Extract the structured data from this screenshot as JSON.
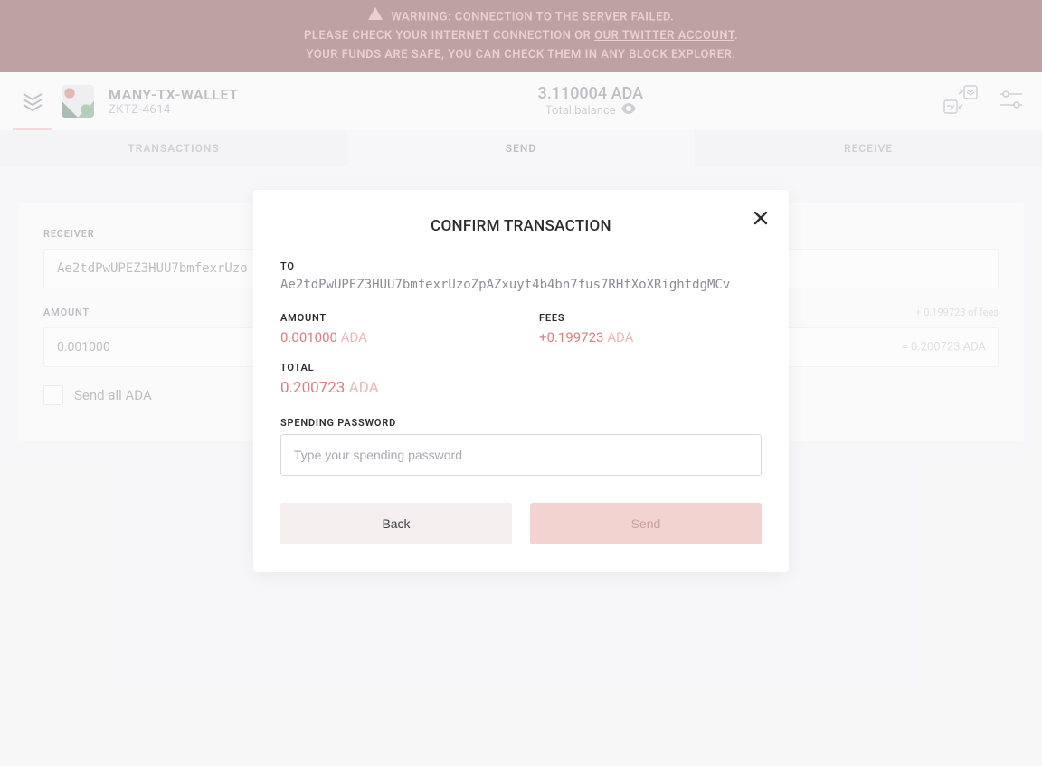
{
  "warning": {
    "line1": "WARNING: CONNECTION TO THE SERVER FAILED.",
    "line2_pre": "PLEASE CHECK YOUR INTERNET CONNECTION OR ",
    "line2_link": "OUR TWITTER ACCOUNT",
    "line2_post": ".",
    "line3": "YOUR FUNDS ARE SAFE, YOU CAN CHECK THEM IN ANY BLOCK EXPLORER."
  },
  "wallet": {
    "name": "MANY-TX-WALLET",
    "subid": "ZKTZ-4614",
    "balance": "3.110004 ADA",
    "balance_label": "Total balance"
  },
  "tabs": {
    "transactions": "TRANSACTIONS",
    "send": "SEND",
    "receive": "RECEIVE"
  },
  "form": {
    "receiver_label": "RECEIVER",
    "receiver_value": "Ae2tdPwUPEZ3HUU7bmfexrUzo",
    "amount_label": "AMOUNT",
    "amount_value": "0.001000",
    "fees_hint": "+ 0.199723 of fees",
    "equals_hint": "= 0.200723 ADA",
    "send_all": "Send all ADA"
  },
  "modal": {
    "title": "CONFIRM TRANSACTION",
    "to_label": "TO",
    "to_value": "Ae2tdPwUPEZ3HUU7bmfexrUzoZpAZxuyt4b4bn7fus7RHfXoXRightdgMCv",
    "amount_label": "AMOUNT",
    "amount_value": "0.001000",
    "amount_unit": " ADA",
    "fees_label": "FEES",
    "fees_value": "+0.199723",
    "fees_unit": " ADA",
    "total_label": "TOTAL",
    "total_value": "0.200723",
    "total_unit": " ADA",
    "password_label": "SPENDING PASSWORD",
    "password_placeholder": "Type your spending password",
    "back": "Back",
    "send": "Send"
  }
}
